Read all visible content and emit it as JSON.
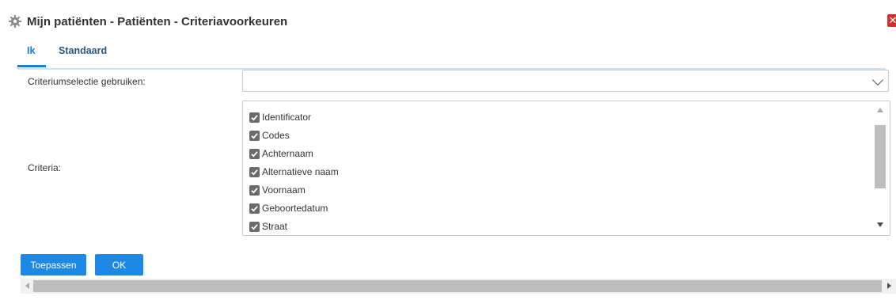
{
  "window": {
    "title": "Mijn patiënten - Patiënten - Criteriavoorkeuren",
    "icon": "gear-icon",
    "close_icon": "close-icon",
    "close_glyph": "✕"
  },
  "tabs": [
    {
      "label": "Ik",
      "active": true
    },
    {
      "label": "Standaard",
      "active": false
    }
  ],
  "form": {
    "selection_label": "Criteriumselectie gebruiken:",
    "selection_value": "",
    "criteria_label": "Criteria:",
    "criteria_items": [
      {
        "label": "Identificator",
        "checked": true
      },
      {
        "label": "Codes",
        "checked": true
      },
      {
        "label": "Achternaam",
        "checked": true
      },
      {
        "label": "Alternatieve naam",
        "checked": true
      },
      {
        "label": "Voornaam",
        "checked": true
      },
      {
        "label": "Geboortedatum",
        "checked": true
      },
      {
        "label": "Straat",
        "checked": true
      }
    ]
  },
  "buttons": {
    "apply": "Toepassen",
    "ok": "OK"
  },
  "colors": {
    "accent": "#1e88e5",
    "active_tab": "#1b7fd0",
    "close": "#d32f2f",
    "checkbox": "#6b6b6b"
  }
}
